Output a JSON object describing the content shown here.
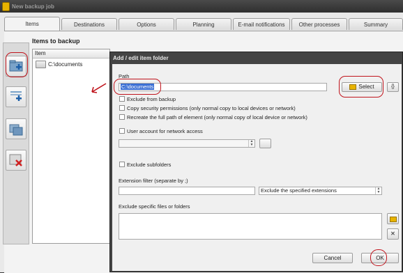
{
  "window": {
    "title": "New backup job"
  },
  "tabs": [
    {
      "label": "Items",
      "active": true
    },
    {
      "label": "Destinations"
    },
    {
      "label": "Options"
    },
    {
      "label": "Planning"
    },
    {
      "label": "E-mail notifications"
    },
    {
      "label": "Other processes"
    },
    {
      "label": "Summary"
    }
  ],
  "items_section": {
    "title": "Items to backup",
    "column_header": "Item",
    "rows": [
      "C:\\documents"
    ]
  },
  "sidebar_buttons": [
    "add-folder-icon",
    "add-file-icon",
    "edit-item-icon",
    "remove-item-icon"
  ],
  "dialog": {
    "title": "Add / edit item folder",
    "path_label": "Path",
    "path_value": "C:\\documents",
    "select_button": "Select",
    "braces_button": "{}",
    "checkboxes": {
      "exclude_from_backup": "Exclude from backup",
      "copy_security": "Copy security permissions (only normal copy to local devices or network)",
      "recreate_path": "Recreate the full path of element (only normal copy of local device or network)",
      "user_account": "User account for network access",
      "exclude_subfolders": "Exclude subfolders"
    },
    "extension_filter_label": "Extension filter (separate by ;)",
    "extension_filter_value": "",
    "extension_mode": "Exclude the specified extensions",
    "exclude_files_label": "Exclude specific files or folders",
    "cancel_button": "Cancel",
    "ok_button": "OK"
  },
  "colors": {
    "highlight_circle": "#c0141c",
    "selection": "#3b6fd4",
    "folder_accent": "#e8b400"
  }
}
